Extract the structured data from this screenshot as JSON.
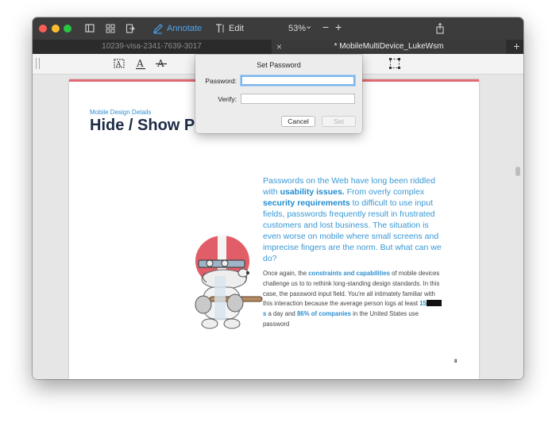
{
  "toolbar": {
    "annotate_label": "Annotate",
    "edit_label": "Edit",
    "zoom_label": "53%",
    "zoom_chevron": "⌄",
    "zoom_minus": "−",
    "zoom_plus": "+"
  },
  "tabs": [
    {
      "label": "10239-visa-2341-7639-3017"
    },
    {
      "label": "* MobileMultiDevice_LukeWsm"
    }
  ],
  "tab_close": "×",
  "tab_add": "+",
  "dialog": {
    "title": "Set Password",
    "password_label": "Password:",
    "verify_label": "Verify:",
    "password_value": "",
    "verify_value": "",
    "cancel_label": "Cancel",
    "set_label": "Set"
  },
  "page": {
    "kicker": "Mobile Design Details",
    "heading": "Hide / Show P",
    "intro": [
      {
        "text": "Passwords on the Web have long been riddled with "
      },
      {
        "text": "usability issues.",
        "bold": true
      },
      {
        "text": " From overly complex "
      },
      {
        "text": "security requirements",
        "bold": true
      },
      {
        "text": " to difficult to use input fields, passwords frequently result in frustrated customers and lost business. The situation is even worse on mobile where small screens and imprecise fingers are the norm. But what can we do?"
      }
    ],
    "body": [
      {
        "text": "Once again, the "
      },
      {
        "text": "constraints and capabilities",
        "bold": true
      },
      {
        "text": " of mobile devices challenge us to to rethink long-standing design standards. In this case, the password input field. You're all intimately familiar with this interaction because the average person logs at least "
      },
      {
        "text": "15",
        "bold": true
      },
      {
        "redact": true
      },
      {
        "text": "s",
        "bold": true
      },
      {
        "text": " a day and "
      },
      {
        "text": "86% of companies",
        "bold": true
      },
      {
        "text": " in the United States use password"
      }
    ],
    "page_number": "8"
  },
  "colors": {
    "accent_blue": "#2f8fd3",
    "heading_navy": "#1d2b46",
    "page_top_bar": "#e26a73",
    "focus_ring": "#7cb5ec"
  }
}
